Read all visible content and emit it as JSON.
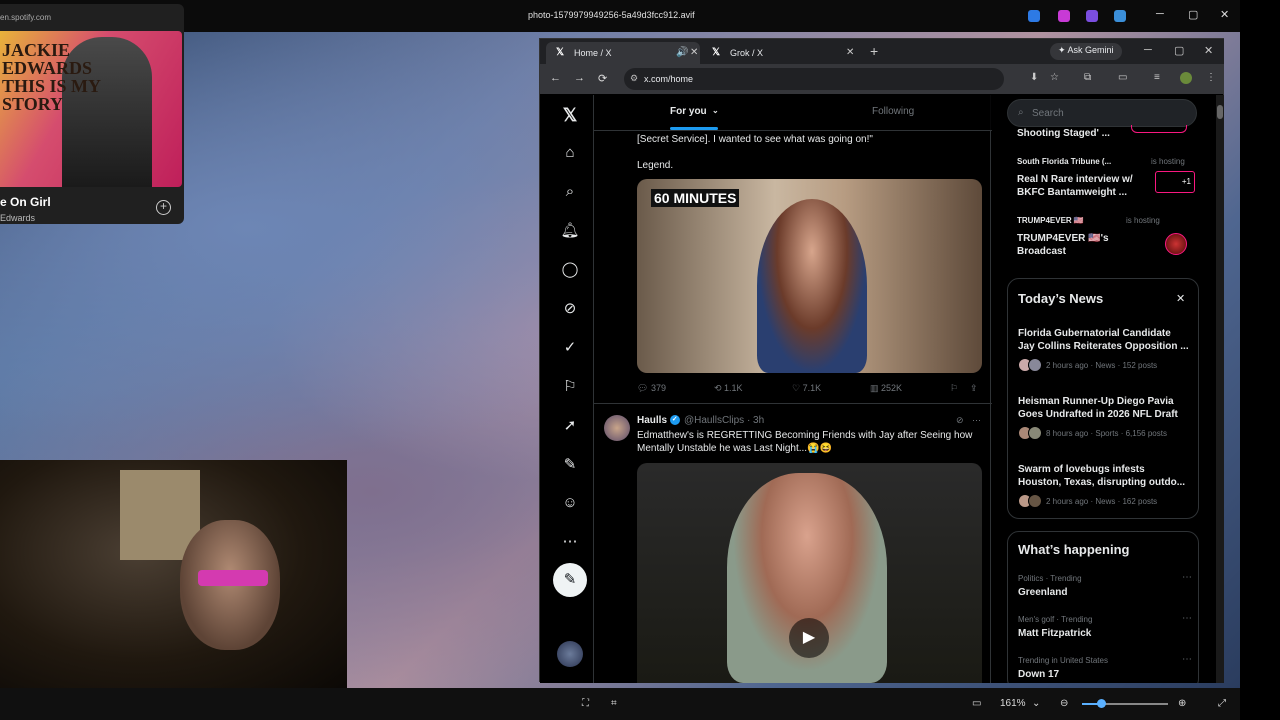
{
  "viewer": {
    "title": "photo-1579979949256-5a49d3fcc912.avif",
    "zoom": "161%",
    "minimize": "─",
    "restore": "▢",
    "close": "✕"
  },
  "spotify": {
    "url": "en.spotify.com",
    "track": "e On Girl",
    "artist": "Edwards",
    "cover_text": "JACKIE EDWARDS THIS IS MY STORY",
    "add": "+"
  },
  "browser": {
    "tabs": [
      {
        "label": "Home / X",
        "active": true
      },
      {
        "label": "Grok / X",
        "active": false
      }
    ],
    "new_tab": "+",
    "gemini": "Ask Gemini",
    "url": "x.com/home",
    "back": "←",
    "forward": "→",
    "reload": "⟳"
  },
  "x": {
    "feed_tabs": {
      "for_you": "For you",
      "following": "Following"
    },
    "nav_icons": [
      "home-icon",
      "search-icon",
      "bell-icon",
      "chat-icon",
      "grok-icon",
      "verified-icon",
      "bookmark-icon",
      "rocket-icon",
      "pen-icon",
      "profile-icon",
      "more-icon"
    ],
    "tweet1": {
      "text_tail": "[Secret Service]. I wanted to see what was going on!\"",
      "text2": "Legend.",
      "media_label": "60 MINUTES",
      "replies": "379",
      "reposts": "1.1K",
      "likes": "7.1K",
      "views": "252K"
    },
    "tweet2": {
      "name": "Haulls",
      "handle": "@HaullsClips · 3h",
      "text": "Edmatthew's is REGRETTING Becoming Friends with Jay after Seeing how Mentally Unstable he was Last Night...😭😆"
    },
    "search_placeholder": "Search",
    "spaces": [
      {
        "title": "Shooting Staged' ..."
      },
      {
        "host": "South Florida Tribune (...",
        "status": "is hosting",
        "title": "Real N Rare interview w/ BKFC Bantamweight ...",
        "badge": "+1"
      },
      {
        "host": "TRUMP4EVER 🇺🇸",
        "status": "is hosting",
        "title": "TRUMP4EVER 🇺🇸's Broadcast"
      }
    ],
    "todays_news": {
      "title": "Today’s News",
      "close": "✕",
      "items": [
        {
          "headline": "Florida Gubernatorial Candidate Jay Collins Reiterates Opposition ...",
          "meta": "2 hours ago · News · 152 posts"
        },
        {
          "headline": "Heisman Runner-Up Diego Pavia Goes Undrafted in 2026 NFL Draft",
          "meta": "8 hours ago · Sports · 6,156 posts"
        },
        {
          "headline": "Swarm of lovebugs infests Houston, Texas, disrupting outdo...",
          "meta": "2 hours ago · News · 162 posts"
        }
      ]
    },
    "whats_happening": {
      "title": "What’s happening",
      "items": [
        {
          "context": "Politics · Trending",
          "name": "Greenland"
        },
        {
          "context": "Men's golf · Trending",
          "name": "Matt Fitzpatrick"
        },
        {
          "context": "Trending in United States",
          "name": "Down 17"
        }
      ]
    }
  },
  "colors": {
    "accent": "#1d9bf0",
    "bg": "#000000",
    "border": "#2f3336"
  }
}
